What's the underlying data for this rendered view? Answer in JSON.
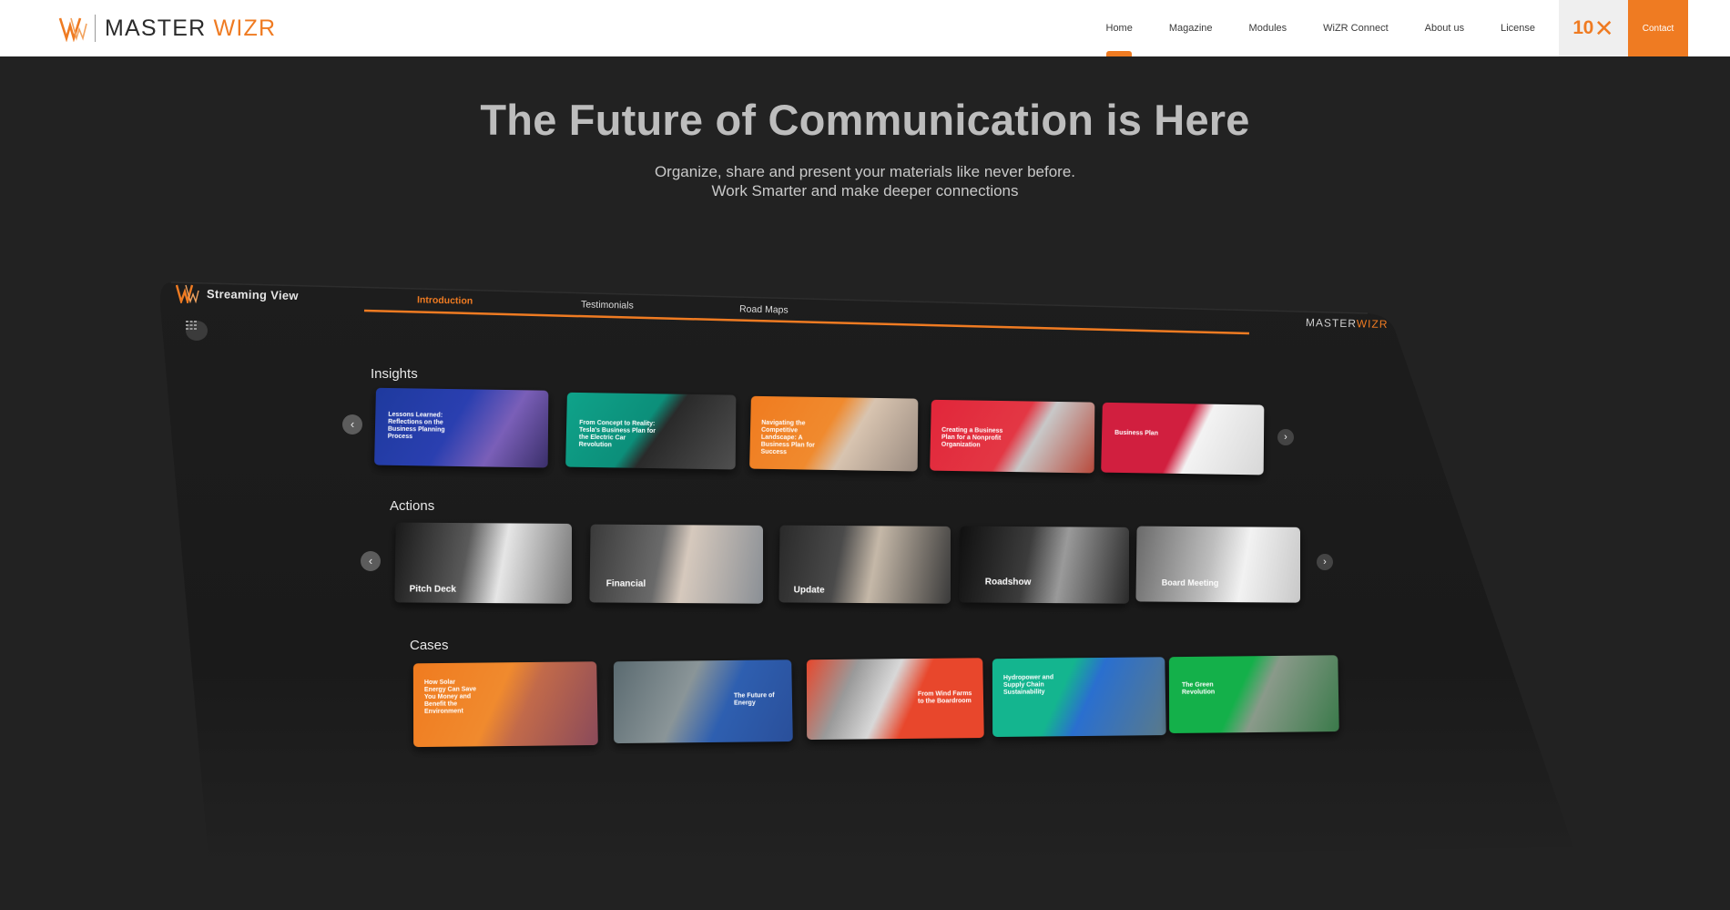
{
  "header": {
    "brand": {
      "name_main": "MASTER",
      "name_accent": "WIZR"
    },
    "nav": [
      {
        "label": "Home",
        "active": true
      },
      {
        "label": "Magazine",
        "active": false
      },
      {
        "label": "Modules",
        "active": false
      },
      {
        "label": "WiZR Connect",
        "active": false
      },
      {
        "label": "About us",
        "active": false
      },
      {
        "label": "License",
        "active": false
      }
    ],
    "badge_10x": "10",
    "contact_label": "Contact"
  },
  "hero": {
    "title": "The Future of Communication is Here",
    "subtitle_line1": "Organize, share and present your materials like never before.",
    "subtitle_line2": "Work Smarter and make deeper connections"
  },
  "app": {
    "title": "Streaming View",
    "brand_main": "MASTER",
    "brand_accent": "WIZR",
    "tabs": [
      {
        "label": "Introduction",
        "active": true
      },
      {
        "label": "Testimonials",
        "active": false
      },
      {
        "label": "Road Maps",
        "active": false
      }
    ],
    "sections": [
      {
        "title": "Insights",
        "cards": [
          {
            "title": "Lessons Learned: Reflections on the Business Planning Process",
            "color": "#2a3fb0"
          },
          {
            "title": "From Concept to Reality: Tesla's Business Plan for the Electric Car Revolution",
            "color": "#0fa38a"
          },
          {
            "title": "Navigating the Competitive Landscape: A Business Plan for Success",
            "color": "#f07b1f"
          },
          {
            "title": "Creating a Business Plan for a Nonprofit Organization",
            "color": "#e2263a"
          },
          {
            "title": "Business Plan",
            "color": "#d11f3f"
          }
        ]
      },
      {
        "title": "Actions",
        "cards": [
          {
            "title": "Pitch Deck",
            "color": "#3a3a3a"
          },
          {
            "title": "Financial",
            "color": "#4a4a4a"
          },
          {
            "title": "Update",
            "color": "#3d3d3d"
          },
          {
            "title": "Roadshow",
            "color": "#2e2e2e"
          },
          {
            "title": "Board Meeting",
            "color": "#5a5a5a"
          }
        ]
      },
      {
        "title": "Cases",
        "cards": [
          {
            "title": "How Solar Energy Can Save You Money and Benefit the Environment",
            "color": "#f07b1f"
          },
          {
            "title": "The Future of Energy",
            "color": "#2e5fb0"
          },
          {
            "title": "From Wind Farms to the Boardroom",
            "color": "#e8472c"
          },
          {
            "title": "Hydropower and Supply Chain Sustainability",
            "color": "#14b58f"
          },
          {
            "title": "The Green Revolution",
            "color": "#14b04a"
          }
        ]
      }
    ]
  },
  "colors": {
    "accent": "#ef7b22",
    "background": "#222222",
    "device": "#1c1c1c"
  },
  "icons": [
    "brand-mark-icon",
    "grid-icon",
    "chevron-left-icon",
    "chevron-right-icon"
  ]
}
